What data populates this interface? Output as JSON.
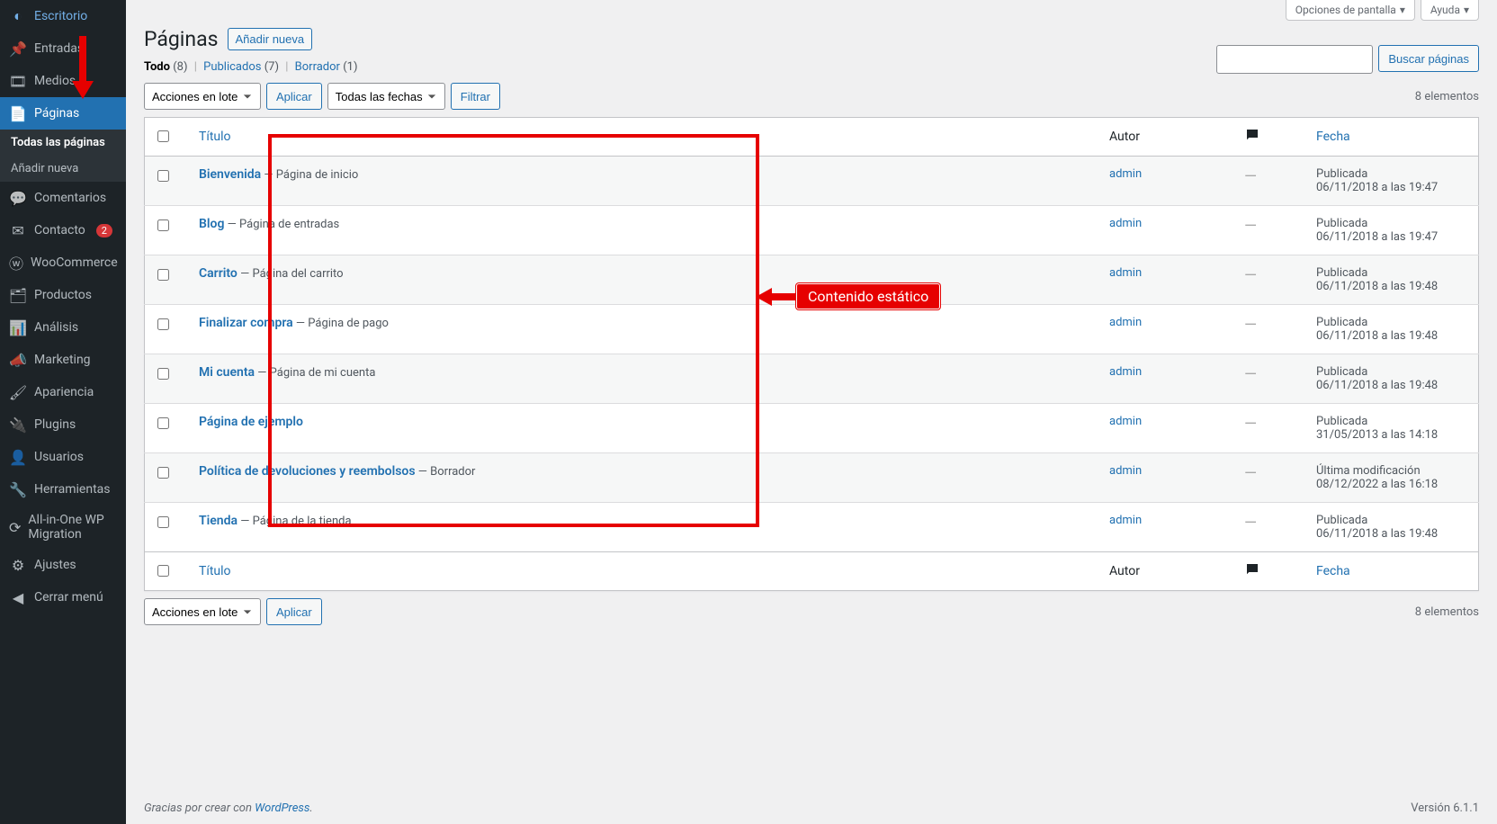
{
  "sidebar": {
    "items": [
      {
        "icon": "dashboard",
        "label": "Escritorio"
      },
      {
        "icon": "pin",
        "label": "Entradas"
      },
      {
        "icon": "media",
        "label": "Medios"
      },
      {
        "icon": "page",
        "label": "Páginas",
        "current": true,
        "submenu": [
          {
            "label": "Todas las páginas",
            "current": true
          },
          {
            "label": "Añadir nueva"
          }
        ]
      },
      {
        "icon": "comment",
        "label": "Comentarios"
      },
      {
        "icon": "mail",
        "label": "Contacto",
        "badge": "2"
      },
      {
        "icon": "woo",
        "label": "WooCommerce"
      },
      {
        "icon": "product",
        "label": "Productos"
      },
      {
        "icon": "analytics",
        "label": "Análisis"
      },
      {
        "icon": "megaphone",
        "label": "Marketing"
      },
      {
        "icon": "appearance",
        "label": "Apariencia"
      },
      {
        "icon": "plugins",
        "label": "Plugins"
      },
      {
        "icon": "users",
        "label": "Usuarios"
      },
      {
        "icon": "tools",
        "label": "Herramientas"
      },
      {
        "icon": "migration",
        "label": "All-in-One WP Migration"
      },
      {
        "icon": "settings",
        "label": "Ajustes"
      },
      {
        "icon": "collapse",
        "label": "Cerrar menú"
      }
    ]
  },
  "topbar": {
    "screen_options": "Opciones de pantalla",
    "help": "Ayuda"
  },
  "header": {
    "title": "Páginas",
    "add_new": "Añadir nueva"
  },
  "filters": {
    "all": "Todo",
    "all_count": "(8)",
    "published": "Publicados",
    "published_count": "(7)",
    "draft": "Borrador",
    "draft_count": "(1)"
  },
  "bulk": {
    "actions": "Acciones en lote",
    "apply": "Aplicar",
    "dates": "Todas las fechas",
    "filter": "Filtrar"
  },
  "search": {
    "button": "Buscar páginas"
  },
  "count": {
    "text": "8 elementos"
  },
  "columns": {
    "title": "Título",
    "author": "Autor",
    "date": "Fecha"
  },
  "rows": [
    {
      "title": "Bienvenida",
      "suffix": " — Página de inicio",
      "author": "admin",
      "status": "Publicada",
      "date": "06/11/2018 a las 19:47"
    },
    {
      "title": "Blog",
      "suffix": " — Página de entradas",
      "author": "admin",
      "status": "Publicada",
      "date": "06/11/2018 a las 19:47"
    },
    {
      "title": "Carrito",
      "suffix": " — Página del carrito",
      "author": "admin",
      "status": "Publicada",
      "date": "06/11/2018 a las 19:48"
    },
    {
      "title": "Finalizar compra",
      "suffix": " — Página de pago",
      "author": "admin",
      "status": "Publicada",
      "date": "06/11/2018 a las 19:48"
    },
    {
      "title": "Mi cuenta",
      "suffix": " — Página de mi cuenta",
      "author": "admin",
      "status": "Publicada",
      "date": "06/11/2018 a las 19:48"
    },
    {
      "title": "Página de ejemplo",
      "suffix": "",
      "author": "admin",
      "status": "Publicada",
      "date": "31/05/2013 a las 14:18"
    },
    {
      "title": "Política de devoluciones y reembolsos",
      "suffix": " — Borrador",
      "author": "admin",
      "status": "Última modificación",
      "date": "08/12/2022 a las 16:18"
    },
    {
      "title": "Tienda",
      "suffix": " — Página de la tienda",
      "author": "admin",
      "status": "Publicada",
      "date": "06/11/2018 a las 19:48"
    }
  ],
  "footer": {
    "thanks_pre": "Gracias por crear con ",
    "wp": "WordPress",
    "dot": ".",
    "version": "Versión 6.1.1"
  },
  "annotation": {
    "label": "Contenido estático"
  }
}
